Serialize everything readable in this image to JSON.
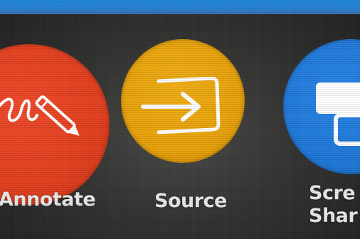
{
  "colors": {
    "top_bar": "#2a7fd0",
    "annotate": "#e2401f",
    "source": "#e8a30c",
    "screen_share": "#1f78d8",
    "background": "#3a3a39",
    "label_text": "#e9e9e9"
  },
  "tiles": [
    {
      "label": "Annotate",
      "icon": "pen-scribble-icon"
    },
    {
      "label": "Source",
      "icon": "input-source-icon"
    },
    {
      "label_line1": "Scre",
      "label_line2": "Shar",
      "icon": "screen-share-icon"
    }
  ]
}
